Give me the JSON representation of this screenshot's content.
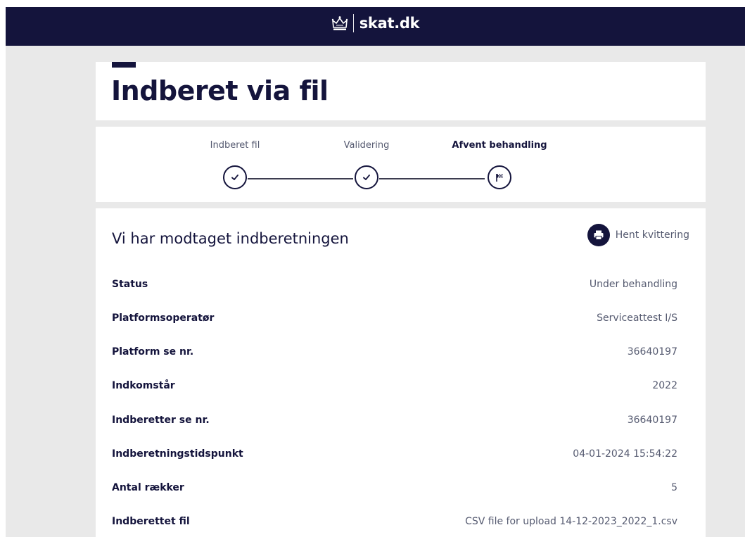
{
  "header": {
    "logo_icon": "crown-icon",
    "brand": "skat.dk",
    "background": "#14143c"
  },
  "page": {
    "title": "Indberet via fil"
  },
  "steps": [
    {
      "label": "Indberet fil",
      "state": "done",
      "icon": "check-icon"
    },
    {
      "label": "Validering",
      "state": "done",
      "icon": "check-icon"
    },
    {
      "label": "Afvent behandling",
      "state": "active",
      "icon": "flag-icon"
    }
  ],
  "receipt": {
    "title": "Vi har modtaget indberetningen",
    "button_label": "Hent kvittering",
    "button_icon": "printer-icon",
    "rows": [
      {
        "label": "Status",
        "value": "Under behandling"
      },
      {
        "label": "Platformsoperatør",
        "value": "Serviceattest I/S"
      },
      {
        "label": "Platform se nr.",
        "value": "36640197"
      },
      {
        "label": "Indkomstår",
        "value": "2022"
      },
      {
        "label": "Indberetter se nr.",
        "value": "36640197"
      },
      {
        "label": "Indberetningstidspunkt",
        "value": "04-01-2024 15:54:22"
      },
      {
        "label": "Antal rækker",
        "value": "5"
      },
      {
        "label": "Indberettet fil",
        "value": "CSV file for upload 14-12-2023_2022_1.csv"
      }
    ]
  },
  "colors": {
    "primary": "#14143c",
    "page_background": "#e9e9e9",
    "muted_text": "#555a70"
  }
}
